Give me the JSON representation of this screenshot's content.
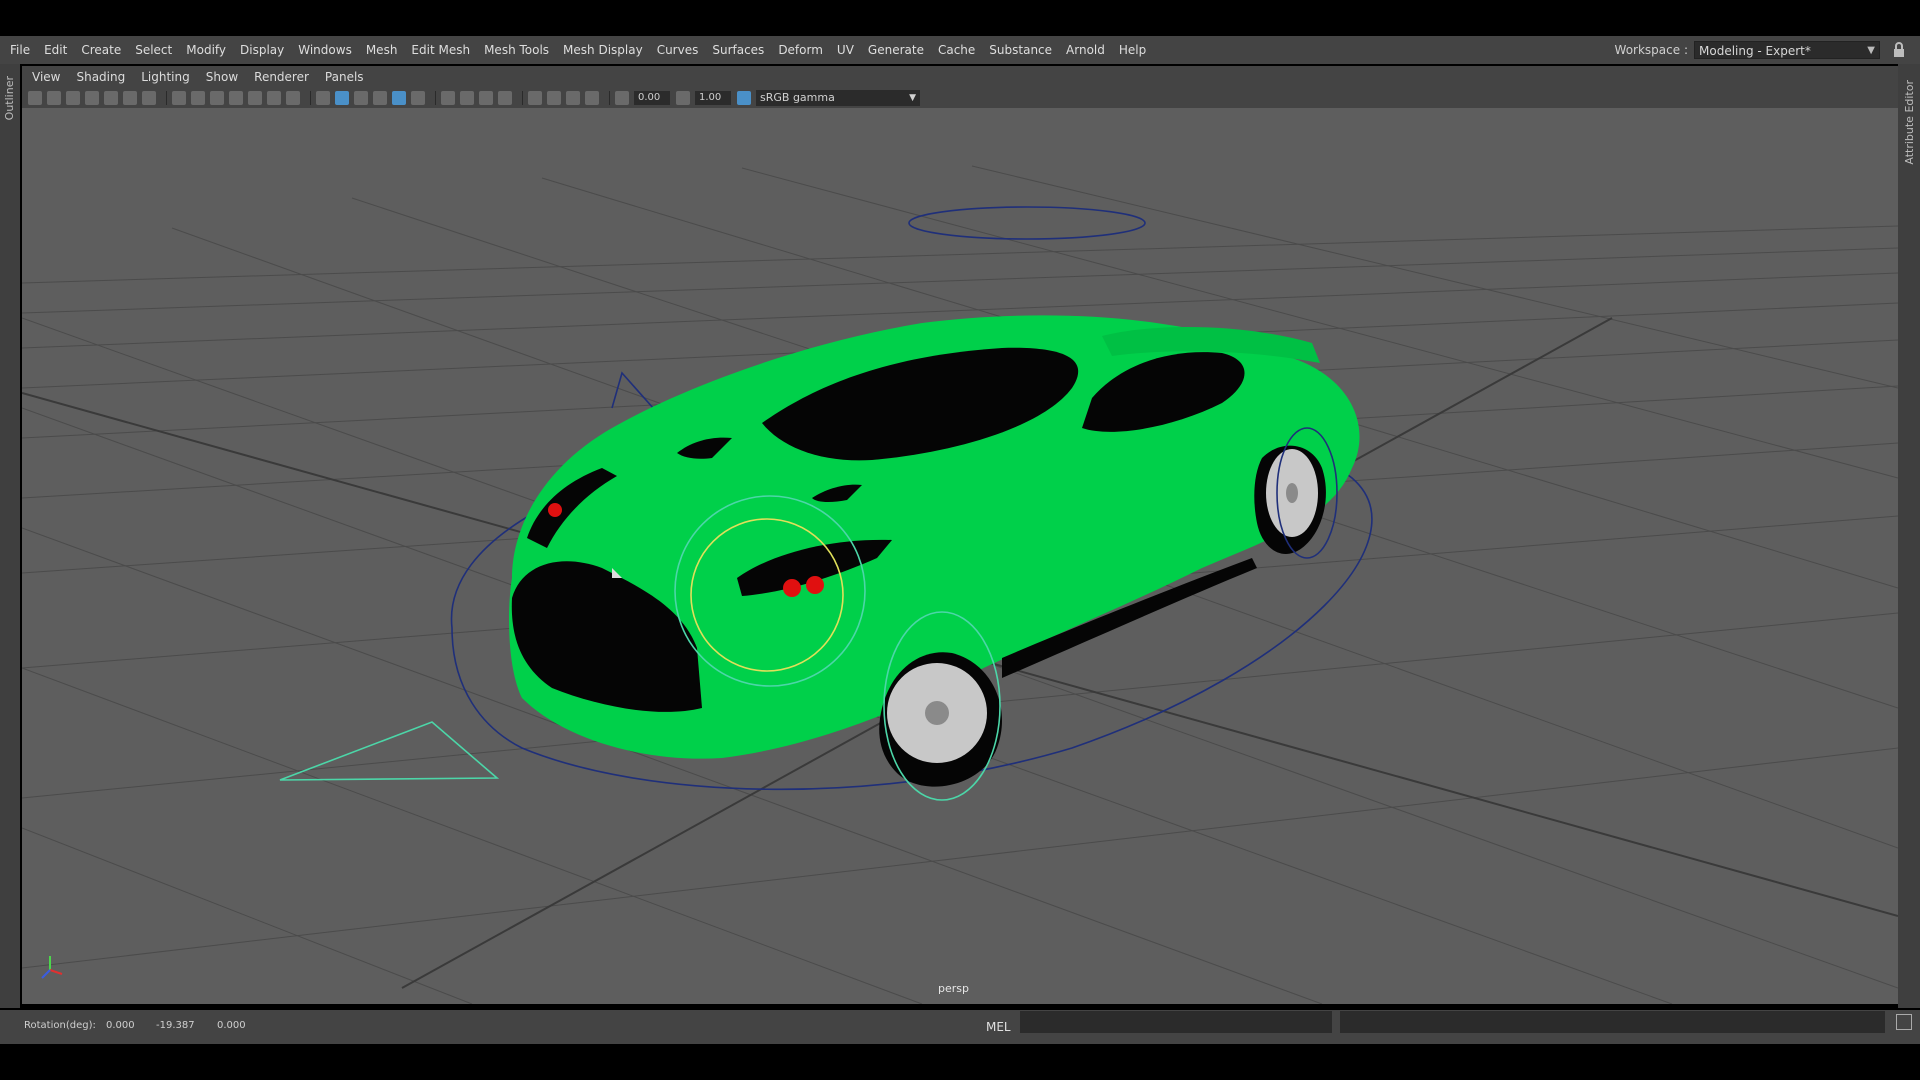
{
  "menubar": {
    "items": [
      "File",
      "Edit",
      "Create",
      "Select",
      "Modify",
      "Display",
      "Windows",
      "Mesh",
      "Edit Mesh",
      "Mesh Tools",
      "Mesh Display",
      "Curves",
      "Surfaces",
      "Deform",
      "UV",
      "Generate",
      "Cache",
      "Substance",
      "Arnold",
      "Help"
    ],
    "workspace_label": "Workspace :",
    "workspace_value": "Modeling - Expert*"
  },
  "side_panels": {
    "left": "Outliner",
    "right": "Attribute Editor"
  },
  "panel_menu": [
    "View",
    "Shading",
    "Lighting",
    "Show",
    "Renderer",
    "Panels"
  ],
  "toolbar": {
    "field1": "0.00",
    "field2": "1.00",
    "color_space": "sRGB gamma"
  },
  "viewport": {
    "camera": "persp",
    "background": "#5e5e5e",
    "car_color": "#00d04a"
  },
  "status": {
    "rotation_label": "Rotation(deg):",
    "rx": "0.000",
    "ry": "-19.387",
    "rz": "0.000",
    "mel": "MEL"
  }
}
